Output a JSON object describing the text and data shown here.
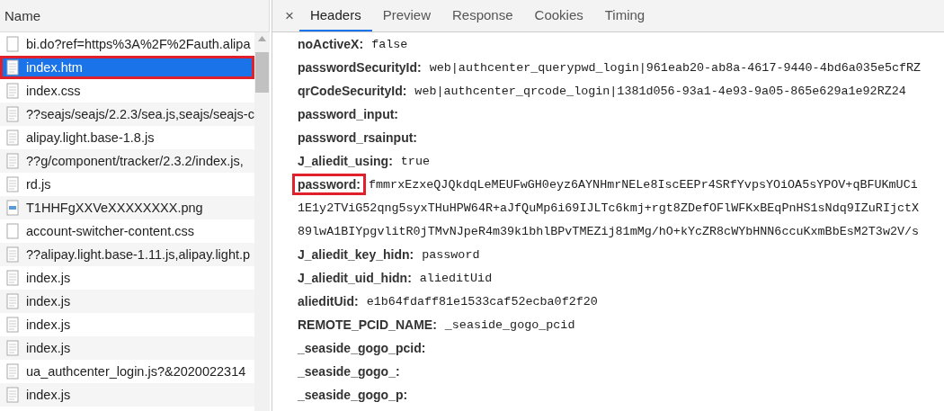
{
  "files_panel": {
    "column_header": "Name",
    "files": [
      {
        "name": "bi.do?ref=https%3A%2F%2Fauth.alipa",
        "kind": "blank",
        "selected": false,
        "highlighted": false
      },
      {
        "name": "index.htm",
        "kind": "doc",
        "selected": true,
        "highlighted": true
      },
      {
        "name": "index.css",
        "kind": "doc",
        "selected": false,
        "highlighted": false
      },
      {
        "name": "??seajs/seajs/2.2.3/sea.js,seajs/seajs-c",
        "kind": "doc",
        "selected": false,
        "highlighted": false
      },
      {
        "name": "alipay.light.base-1.8.js",
        "kind": "doc",
        "selected": false,
        "highlighted": false
      },
      {
        "name": "??g/component/tracker/2.3.2/index.js,",
        "kind": "doc",
        "selected": false,
        "highlighted": false
      },
      {
        "name": "rd.js",
        "kind": "doc",
        "selected": false,
        "highlighted": false
      },
      {
        "name": "T1HHFgXXVeXXXXXXXX.png",
        "kind": "image",
        "selected": false,
        "highlighted": false
      },
      {
        "name": "account-switcher-content.css",
        "kind": "blank",
        "selected": false,
        "highlighted": false
      },
      {
        "name": "??alipay.light.base-1.11.js,alipay.light.p",
        "kind": "doc",
        "selected": false,
        "highlighted": false
      },
      {
        "name": "index.js",
        "kind": "doc",
        "selected": false,
        "highlighted": false
      },
      {
        "name": "index.js",
        "kind": "doc",
        "selected": false,
        "highlighted": false
      },
      {
        "name": "index.js",
        "kind": "doc",
        "selected": false,
        "highlighted": false
      },
      {
        "name": "index.js",
        "kind": "doc",
        "selected": false,
        "highlighted": false
      },
      {
        "name": "ua_authcenter_login.js?&2020022314",
        "kind": "doc",
        "selected": false,
        "highlighted": false
      },
      {
        "name": "index.js",
        "kind": "doc",
        "selected": false,
        "highlighted": false
      }
    ]
  },
  "detail_panel": {
    "close": "×",
    "tabs": [
      {
        "label": "Headers",
        "selected": true
      },
      {
        "label": "Preview",
        "selected": false
      },
      {
        "label": "Response",
        "selected": false
      },
      {
        "label": "Cookies",
        "selected": false
      },
      {
        "label": "Timing",
        "selected": false
      }
    ],
    "fields": [
      {
        "name": "noActiveX:",
        "value": [
          "false"
        ],
        "highlighted": false
      },
      {
        "name": "passwordSecurityId:",
        "value": [
          "web|authcenter_querypwd_login|961eab20-ab8a-4617-9440-4bd6a035e5cfRZ"
        ],
        "highlighted": false
      },
      {
        "name": "qrCodeSecurityId:",
        "value": [
          "web|authcenter_qrcode_login|1381d056-93a1-4e93-9a05-865e629a1e92RZ24"
        ],
        "highlighted": false
      },
      {
        "name": "password_input:",
        "highlighted": false
      },
      {
        "name": "password_rsainput:",
        "highlighted": false
      },
      {
        "name": "J_aliedit_using:",
        "value": [
          "true"
        ],
        "highlighted": false
      },
      {
        "name": "password:",
        "value": [
          "fmmrxEzxeQJQkdqLeMEUFwGH0eyz6AYNHmrNELe8IscEEPr4SRfYvpsYOiOA5sYPOV+qBFUKmUCi",
          "1E1y2TViG52qng5syxTHuHPW64R+aJfQuMp6i69IJLTc6kmj+rgt8ZDefOFlWFKxBEqPnHS1sNdq9IZuRIjctX",
          "89lwA1BIYpgvlitR0jTMvNJpeR4m39k1bhlBPvTMEZij81mMg/hO+kYcZR8cWYbHNN6ccuKxmBbEsM2T3w2V/s"
        ],
        "highlighted": true
      },
      {
        "name": "J_aliedit_key_hidn:",
        "value": [
          "password"
        ],
        "highlighted": false
      },
      {
        "name": "J_aliedit_uid_hidn:",
        "value": [
          "alieditUid"
        ],
        "highlighted": false
      },
      {
        "name": "alieditUid:",
        "value": [
          "e1b64fdaff81e1533caf52ecba0f2f20"
        ],
        "highlighted": false
      },
      {
        "name": "REMOTE_PCID_NAME:",
        "value": [
          "_seaside_gogo_pcid"
        ],
        "highlighted": false
      },
      {
        "name": "_seaside_gogo_pcid:",
        "highlighted": false
      },
      {
        "name": "_seaside_gogo_:",
        "highlighted": false
      },
      {
        "name": "_seaside_gogo_p:",
        "highlighted": false
      }
    ]
  }
}
